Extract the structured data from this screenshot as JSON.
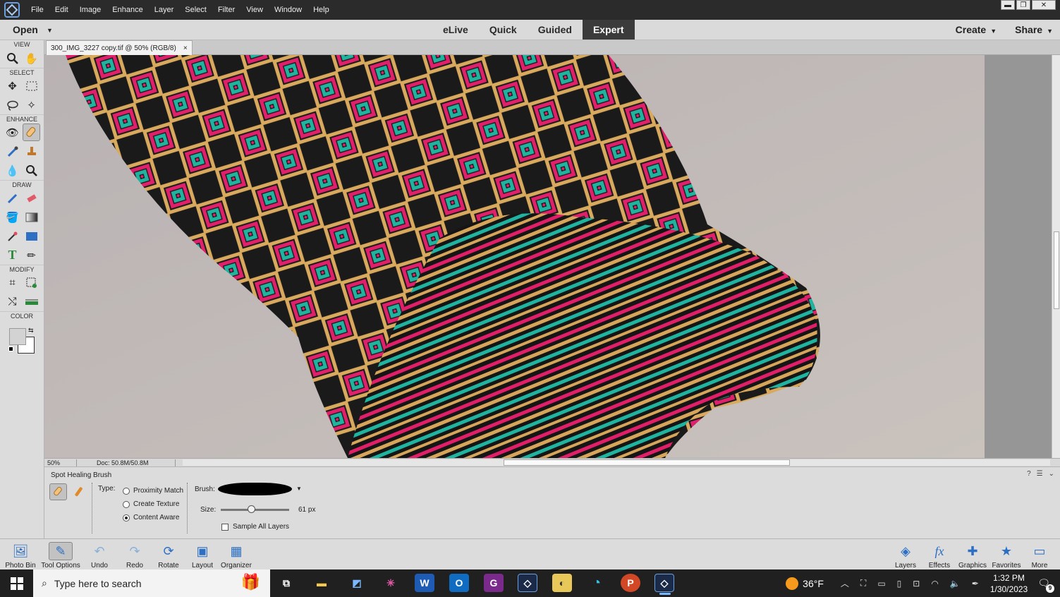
{
  "menu": [
    "File",
    "Edit",
    "Image",
    "Enhance",
    "Layer",
    "Select",
    "Filter",
    "View",
    "Window",
    "Help"
  ],
  "window_controls": {
    "minimize": "▬",
    "restore": "❐",
    "close": "✕"
  },
  "modebar": {
    "open_label": "Open",
    "modes": [
      "eLive",
      "Quick",
      "Guided",
      "Expert"
    ],
    "active_mode": "Expert",
    "create_label": "Create",
    "share_label": "Share"
  },
  "toolbox": {
    "sections": {
      "view": "VIEW",
      "select": "SELECT",
      "enhance": "ENHANCE",
      "draw": "DRAW",
      "modify": "MODIFY",
      "color": "COLOR"
    },
    "foreground_color": "#d3d3d3",
    "background_color": "#ffffff"
  },
  "document": {
    "tab_title": "300_IMG_3227 copy.tif @ 50% (RGB/8)",
    "close_glyph": "×"
  },
  "status": {
    "zoom": "50%",
    "doc_size": "Doc: 50.8M/50.8M"
  },
  "tool_options": {
    "tool_name": "Spot Healing Brush",
    "type_label": "Type:",
    "types": [
      "Proximity Match",
      "Create Texture",
      "Content Aware"
    ],
    "selected_type": "Content Aware",
    "brush_label": "Brush:",
    "size_label": "Size:",
    "size_value": "61 px",
    "size_fraction": 0.44,
    "sample_all_layers_label": "Sample All Layers",
    "sample_all_layers_checked": false
  },
  "panelbar": {
    "left": [
      "Photo Bin",
      "Tool Options",
      "Undo",
      "Redo",
      "Rotate",
      "Layout",
      "Organizer"
    ],
    "right": [
      "Layers",
      "Effects",
      "Graphics",
      "Favorites",
      "More"
    ]
  },
  "taskbar": {
    "search_placeholder": "Type here to search",
    "weather_temp": "36°F",
    "time": "1:32 PM",
    "date": "1/30/2023",
    "notification_count": "9"
  }
}
